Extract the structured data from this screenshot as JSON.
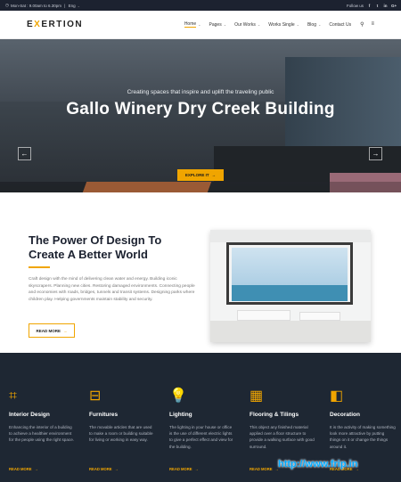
{
  "topbar": {
    "hours": "Mon-Sat : 9.00am to 6.30pm",
    "language": "Eng",
    "follow_label": "Follow us",
    "social": [
      "f",
      "t",
      "in",
      "G+"
    ]
  },
  "nav": {
    "logo_prefix": "E",
    "logo_accent": "X",
    "logo_suffix": "ERTION",
    "items": [
      {
        "label": "Home",
        "caret": "⌄"
      },
      {
        "label": "Pages",
        "caret": "⌄"
      },
      {
        "label": "Our Works",
        "caret": "⌄"
      },
      {
        "label": "Works Single",
        "caret": "⌄"
      },
      {
        "label": "Blog",
        "caret": "⌄"
      },
      {
        "label": "Contact Us",
        "caret": ""
      }
    ]
  },
  "hero": {
    "tagline": "Creating spaces that inspire and uplift the traveling public",
    "title": "Gallo Winery Dry Creek Building",
    "cta_label": "EXPLORE IT",
    "prev": "←",
    "next": "→"
  },
  "about": {
    "heading": "The Power Of Design To Create A Better World",
    "body": "Craft design with the mind of delivering clean water and energy. Building iconic skyscrapers. Planning new cities. Restoring damaged environments. Connecting people and economies with roads, bridges, tunnels and transit systems. Designing parks where children play. Helping governments maintain stability and security.",
    "read_more": "READ MORE",
    "arrow": "→"
  },
  "services": [
    {
      "icon": "blueprint-icon",
      "glyph": "⌗",
      "title": "Interior Design",
      "text": "Enhancing the interior of a building to achieve a healthier environment for the people using the right space.",
      "more": "READ MORE"
    },
    {
      "icon": "ladder-icon",
      "glyph": "⊟",
      "title": "Furnitures",
      "text": "The movable articles that are used to make a room or building suitable for living or working in easy way.",
      "more": "READ MORE"
    },
    {
      "icon": "bulb-icon",
      "glyph": "💡",
      "title": "Lighting",
      "text": "The lighting in your house or office is the use of different electric lights to give a perfect effect and view for the building.",
      "more": "READ MORE"
    },
    {
      "icon": "tiles-icon",
      "glyph": "▦",
      "title": "Flooring & Tilings",
      "text": "This object any finished material applied over a floor structure to provide a walking surface with good surround.",
      "more": "READ MORE"
    },
    {
      "icon": "palette-icon",
      "glyph": "◧",
      "title": "Decoration",
      "text": "It is the activity of making something look more attractive by putting things on it or change the things around it.",
      "more": "READ MORE"
    }
  ],
  "watermark": "http://www.frip.in",
  "colors": {
    "accent": "#f0a500",
    "dark": "#1e2733"
  }
}
